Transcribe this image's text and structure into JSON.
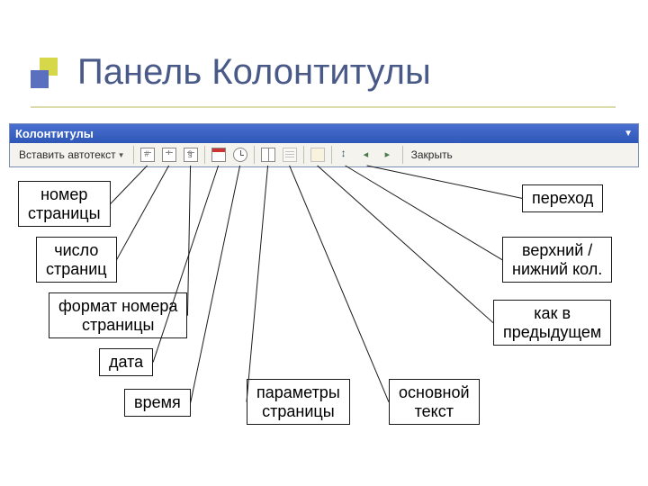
{
  "title": "Панель Колонтитулы",
  "toolbar": {
    "title": "Колонтитулы",
    "autotext": "Вставить автотекст",
    "close": "Закрыть"
  },
  "labels": {
    "page_number": "номер\nстраницы",
    "page_count": "число\nстраниц",
    "number_format": "формат номера\nстраницы",
    "date": "дата",
    "time": "время",
    "page_setup": "параметры\nстраницы",
    "body_text": "основной\nтекст",
    "same_as_prev": "как в\nпредыдущем",
    "switch_hf": "верхний /\nнижний кол.",
    "goto": "переход"
  }
}
